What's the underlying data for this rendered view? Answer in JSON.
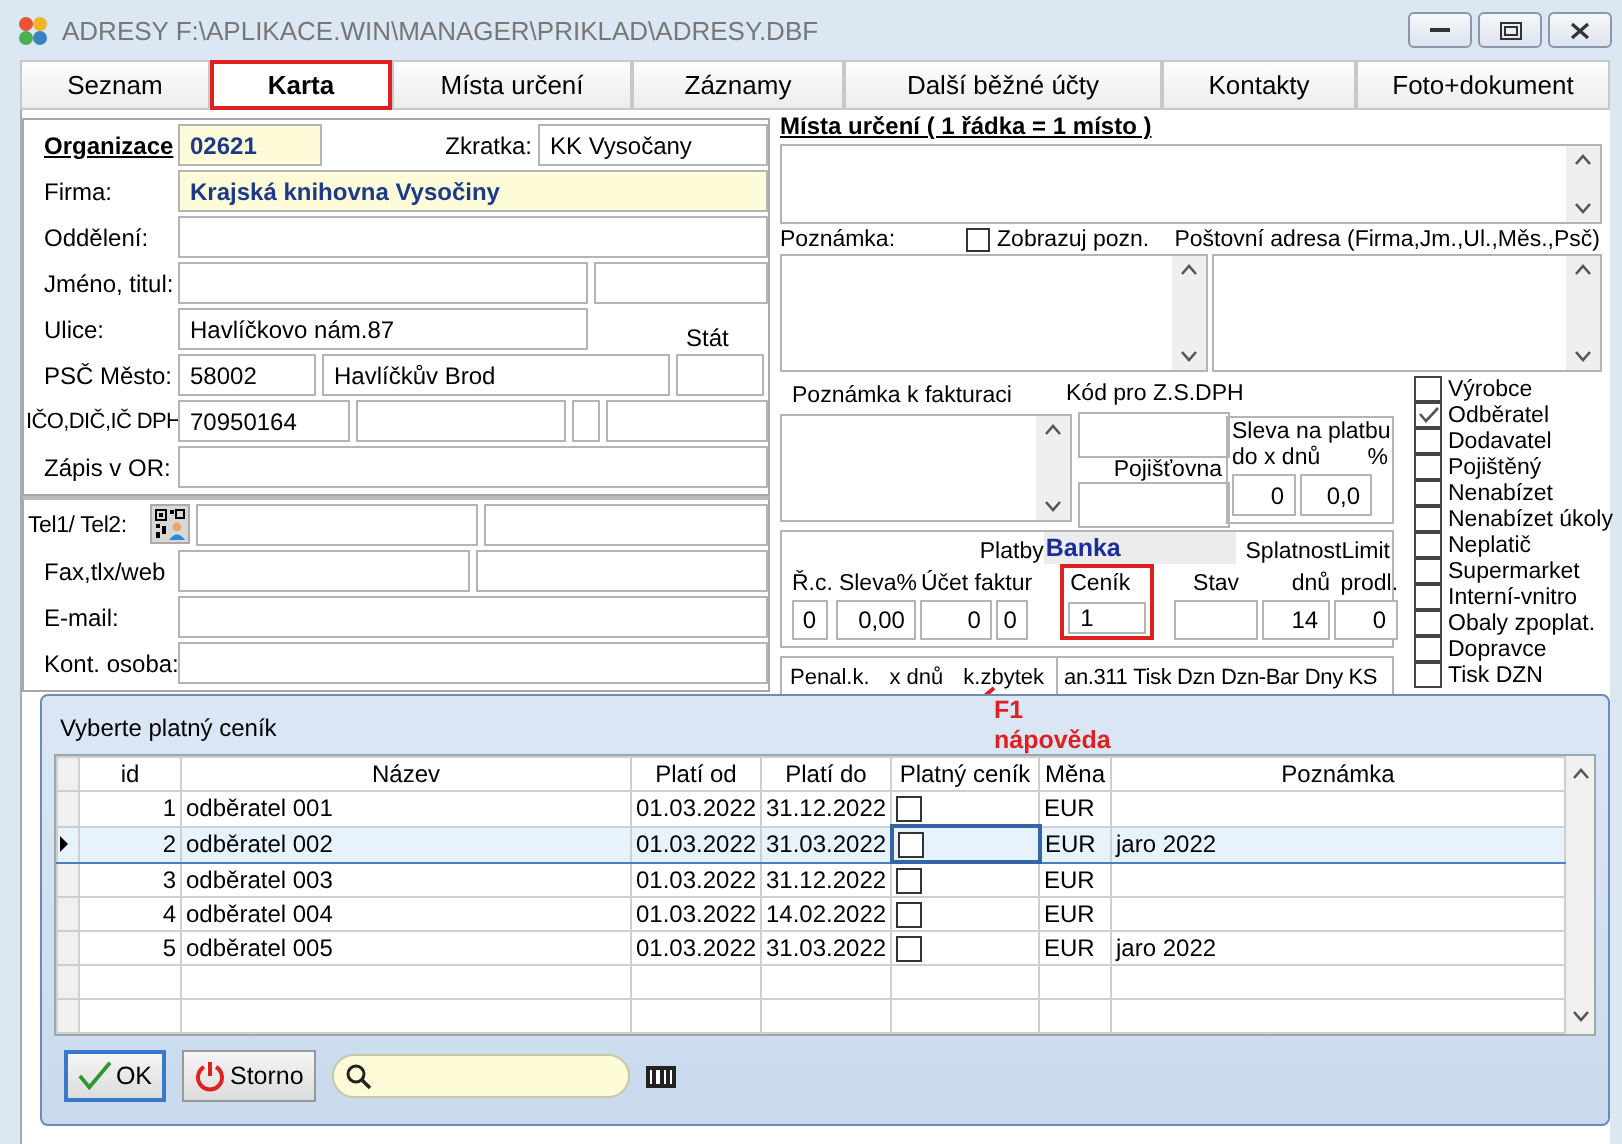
{
  "window": {
    "title": "ADRESY F:\\APLIKACE.WIN\\MANAGER\\PRIKLAD\\ADRESY.DBF"
  },
  "tabs": [
    {
      "label": "Seznam",
      "selected": false,
      "highlighted": false
    },
    {
      "label": "Karta",
      "selected": true,
      "highlighted": true
    },
    {
      "label": "Místa určení",
      "selected": false,
      "highlighted": false
    },
    {
      "label": "Záznamy",
      "selected": false,
      "highlighted": false
    },
    {
      "label": "Další běžné účty",
      "selected": false,
      "highlighted": false
    },
    {
      "label": "Kontakty",
      "selected": false,
      "highlighted": false
    },
    {
      "label": "Foto+dokument",
      "selected": false,
      "highlighted": false
    }
  ],
  "card": {
    "rows": [
      {
        "kind": "org",
        "label": "Organizace",
        "values": [
          "02621",
          "KK Vysočany"
        ],
        "label_2": "Zkratka:",
        "key_field": true
      },
      {
        "kind": "wide",
        "label": "Firma:",
        "values": [
          "Krajská knihovna Vysočiny"
        ],
        "key_field": true
      },
      {
        "kind": "wide",
        "label": "Oddělení:",
        "values": [],
        "key_field": false
      },
      {
        "kind": "pair",
        "label": "Jméno, titul:",
        "values": [],
        "key_field": false
      },
      {
        "kind": "street",
        "label": "Ulice:",
        "values": [
          "Havlíčkovo nám.87"
        ],
        "label_2": "Stát",
        "key_field": false
      },
      {
        "kind": "city",
        "label": "PSČ   Město:",
        "values": [
          "58002",
          "Havlíčkův Brod"
        ],
        "key_field": false
      },
      {
        "kind": "ids",
        "label": "IČO,DIČ,IČ DPH",
        "values": [
          "70950164"
        ],
        "key_field": false
      },
      {
        "kind": "wide",
        "label": "Zápis v OR:",
        "values": [],
        "key_field": false
      },
      {
        "kind": "phone",
        "label": "Tel1/ Tel2:",
        "values": [],
        "key_field": false
      },
      {
        "kind": "halves",
        "label": "Fax,tlx/web",
        "values": [],
        "key_field": false
      },
      {
        "kind": "wide",
        "label": "E-mail:",
        "values": [],
        "key_field": false
      },
      {
        "kind": "wide",
        "label": "Kont. osoba:",
        "values": [],
        "key_field": false
      }
    ]
  },
  "destinations": {
    "title": "Místa určení ( 1 řádka = 1 místo )"
  },
  "notes": {
    "label": "Poznámka:",
    "show_note": {
      "label": "Zobrazuj pozn.",
      "checked": false
    },
    "postal_label": "Poštovní adresa (Firma,Jm.,Ul.,Měs.,Psč)"
  },
  "invoicing": {
    "note_label": "Poznámka k fakturaci",
    "vat_label": "Kód pro Z.S.DPH",
    "insurance_label": "Pojišťovna",
    "discount": {
      "title": "Sleva na platbu",
      "days_label": "do x dnů",
      "percent_label": "%",
      "days": "0",
      "percent": "0,0"
    }
  },
  "payments": {
    "label": "Platby",
    "method": "Banka",
    "due_label": "Splatnost",
    "limit_label": "Limit",
    "fields": [
      {
        "label": "Ř.c.",
        "value": "0",
        "highlighted": false
      },
      {
        "label": "Sleva%",
        "value": "0,00",
        "highlighted": false
      },
      {
        "label": "Účet faktur",
        "value": "0",
        "highlighted": false
      },
      {
        "value": "0",
        "highlighted": false
      },
      {
        "label": "Ceník",
        "value": "1",
        "highlighted": true
      },
      {
        "label": "Stav",
        "highlighted": false
      },
      {
        "label": "dnů",
        "value": "14",
        "highlighted": false
      },
      {
        "label": "prodl.",
        "value": "0",
        "highlighted": false
      }
    ]
  },
  "penalties": {
    "labels": [
      "Penal.k.",
      "x dnů",
      "k.zbytek"
    ],
    "labels_2": [
      "an.311",
      "Tisk Dzn",
      "Dzn-Bar",
      "Dny KS"
    ]
  },
  "flags": [
    {
      "label": "Výrobce",
      "checked": false
    },
    {
      "label": "Odběratel",
      "checked": true
    },
    {
      "label": "Dodavatel",
      "checked": false
    },
    {
      "label": "Pojištěný",
      "checked": false
    },
    {
      "label": "Nenabízet",
      "checked": false
    },
    {
      "label": "Nenabízet úkoly",
      "checked": false
    },
    {
      "label": "Neplatič",
      "checked": false
    },
    {
      "label": "Supermarket",
      "checked": false
    },
    {
      "label": "Interní-vnitro",
      "checked": false
    },
    {
      "label": "Obaly zpoplat.",
      "checked": false
    },
    {
      "label": "Dopravce",
      "checked": false
    },
    {
      "label": "Tisk DZN",
      "checked": false
    }
  ],
  "dialog": {
    "title": "Vyberte platný ceník",
    "columns": [
      "id",
      "Název",
      "Platí od",
      "Platí do",
      "Platný ceník",
      "Měna",
      "Poznámka"
    ],
    "rows": [
      {
        "id": "1",
        "name": "odběratel 001",
        "from": "01.03.2022",
        "to": "31.12.2022",
        "valid": false,
        "currency": "EUR",
        "selected": false
      },
      {
        "id": "2",
        "name": "odběratel 002",
        "from": "01.03.2022",
        "to": "31.03.2022",
        "valid": false,
        "currency": "EUR",
        "note": "jaro 2022",
        "selected": true
      },
      {
        "id": "3",
        "name": "odběratel 003",
        "from": "01.03.2022",
        "to": "31.12.2022",
        "valid": false,
        "currency": "EUR",
        "selected": false
      },
      {
        "id": "4",
        "name": "odběratel 004",
        "from": "01.03.2022",
        "to": "14.02.2022",
        "valid": false,
        "currency": "EUR",
        "selected": false
      },
      {
        "id": "5",
        "name": "odběratel 005",
        "from": "01.03.2022",
        "to": "31.03.2022",
        "valid": false,
        "currency": "EUR",
        "note": "jaro 2022",
        "selected": false
      }
    ],
    "ok_label": "OK",
    "cancel_label": "Storno"
  },
  "annotation": {
    "key": "F1",
    "label": "nápověda"
  }
}
